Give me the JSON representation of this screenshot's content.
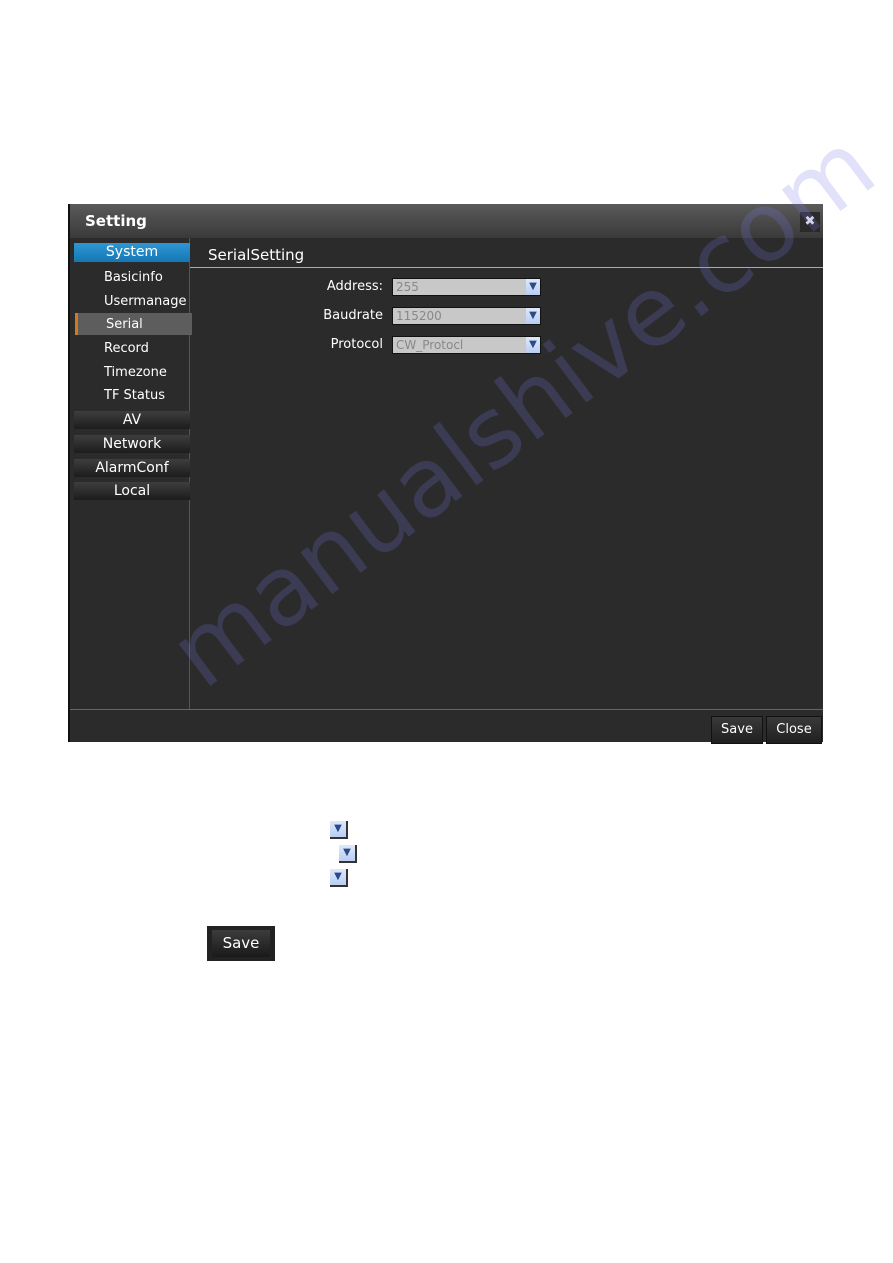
{
  "dialog": {
    "title": "Setting",
    "close_icon": "close-x-icon",
    "sidebar": {
      "group_active": "System",
      "items": [
        "Basicinfo",
        "Usermanage",
        "Serial",
        "Record",
        "Timezone",
        "TF Status"
      ],
      "selected": "Serial",
      "groups": [
        "AV",
        "Network",
        "AlarmConf",
        "Local"
      ]
    },
    "content": {
      "heading": "SerialSetting",
      "fields": [
        {
          "label": "Address:",
          "value": "255"
        },
        {
          "label": "Baudrate",
          "value": "115200"
        },
        {
          "label": "Protocol",
          "value": "CW_Protocl"
        }
      ]
    },
    "footer": {
      "save": "Save",
      "close": "Close"
    }
  },
  "doc": {
    "dropdown_icon": "chevron-down-icon",
    "save": "Save"
  },
  "colors": {
    "accent": "#1a82c4",
    "selected_marker": "#d07a1f"
  },
  "watermark": "manualshive.com"
}
